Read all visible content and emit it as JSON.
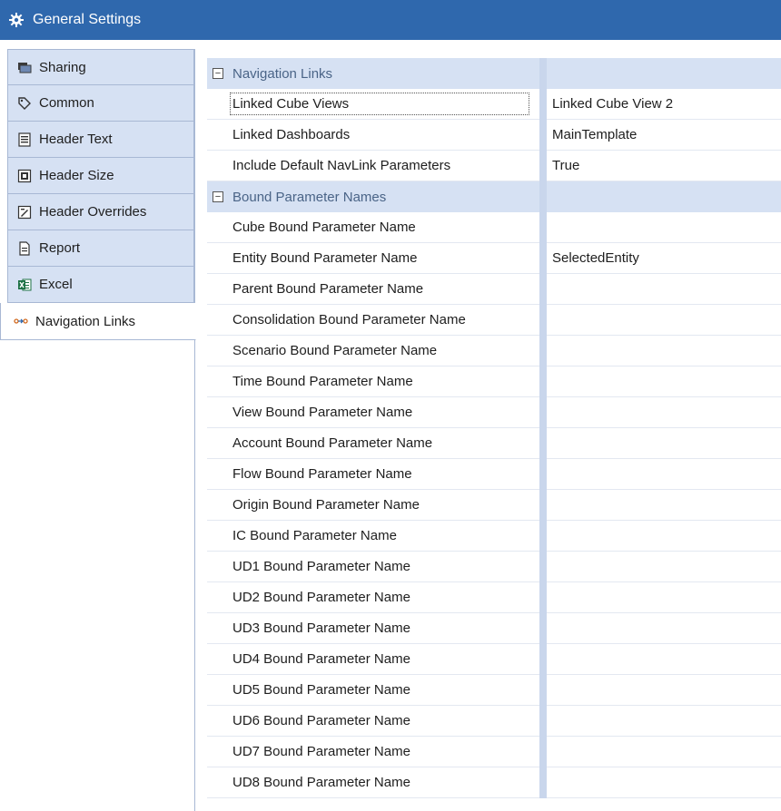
{
  "window": {
    "title": "General Settings",
    "title_icon": "gear-icon"
  },
  "tabs": [
    {
      "label": "Sharing",
      "icon": "sharing-icon",
      "active": false
    },
    {
      "label": "Common",
      "icon": "tag-icon",
      "active": false
    },
    {
      "label": "Header Text",
      "icon": "header-text-icon",
      "active": false
    },
    {
      "label": "Header Size",
      "icon": "header-size-icon",
      "active": false
    },
    {
      "label": "Header Overrides",
      "icon": "header-overrides-icon",
      "active": false
    },
    {
      "label": "Report",
      "icon": "report-icon",
      "active": false
    },
    {
      "label": "Excel",
      "icon": "excel-icon",
      "active": false
    },
    {
      "label": "Navigation Links",
      "icon": "navigation-links-icon",
      "active": true
    }
  ],
  "grid": {
    "categories": [
      {
        "label": "Navigation Links",
        "expanded": true,
        "properties": [
          {
            "name": "Linked Cube Views",
            "value": "Linked Cube View 2"
          },
          {
            "name": "Linked Dashboards",
            "value": "MainTemplate"
          },
          {
            "name": "Include Default NavLink Parameters",
            "value": "True"
          }
        ]
      },
      {
        "label": "Bound Parameter Names",
        "expanded": true,
        "properties": [
          {
            "name": "Cube Bound Parameter Name",
            "value": ""
          },
          {
            "name": "Entity Bound Parameter Name",
            "value": "SelectedEntity"
          },
          {
            "name": "Parent Bound Parameter Name",
            "value": ""
          },
          {
            "name": "Consolidation Bound Parameter Name",
            "value": ""
          },
          {
            "name": "Scenario Bound Parameter Name",
            "value": ""
          },
          {
            "name": "Time Bound Parameter Name",
            "value": ""
          },
          {
            "name": "View Bound Parameter Name",
            "value": ""
          },
          {
            "name": "Account Bound Parameter Name",
            "value": ""
          },
          {
            "name": "Flow Bound Parameter Name",
            "value": ""
          },
          {
            "name": "Origin Bound Parameter Name",
            "value": ""
          },
          {
            "name": "IC Bound Parameter Name",
            "value": ""
          },
          {
            "name": "UD1 Bound Parameter Name",
            "value": ""
          },
          {
            "name": "UD2 Bound Parameter Name",
            "value": ""
          },
          {
            "name": "UD3 Bound Parameter Name",
            "value": ""
          },
          {
            "name": "UD4 Bound Parameter Name",
            "value": ""
          },
          {
            "name": "UD5 Bound Parameter Name",
            "value": ""
          },
          {
            "name": "UD6 Bound Parameter Name",
            "value": ""
          },
          {
            "name": "UD7 Bound Parameter Name",
            "value": ""
          },
          {
            "name": "UD8 Bound Parameter Name",
            "value": ""
          }
        ]
      }
    ],
    "expander_glyph": "−"
  },
  "colors": {
    "titlebar": "#2f68ad",
    "tab_bg": "#d6e1f3",
    "category_bg": "#d6e1f3",
    "category_text": "#4a6487",
    "splitter": "#c9d6ec"
  }
}
